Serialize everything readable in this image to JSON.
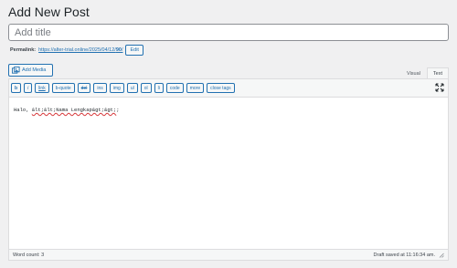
{
  "page": {
    "title": "Add New Post"
  },
  "title_field": {
    "placeholder": "Add title",
    "value": ""
  },
  "permalink": {
    "label": "Permalink:",
    "base": "https://alter-trial.online/2025/04/12/",
    "slug": "90",
    "tail": "/",
    "edit_label": "Edit"
  },
  "media": {
    "add_media_label": "Add Media"
  },
  "editor_tabs": [
    {
      "label": "Visual",
      "active": false
    },
    {
      "label": "Text",
      "active": true
    }
  ],
  "toolbar": {
    "buttons": [
      "b",
      "i",
      "link",
      "b-quote",
      "del",
      "ins",
      "img",
      "ul",
      "ol",
      "li",
      "code",
      "more",
      "close tags"
    ]
  },
  "content": {
    "prefix": "Halo, ",
    "spelled": "&lt;&lt;Nama Lengkap&gt;&gt;",
    "suffix": ";"
  },
  "status": {
    "word_count": "Word count: 3",
    "draft_saved": "Draft saved at 11:16:34 am."
  },
  "colors": {
    "accent": "#2271b1",
    "background": "#f0f0f1"
  }
}
